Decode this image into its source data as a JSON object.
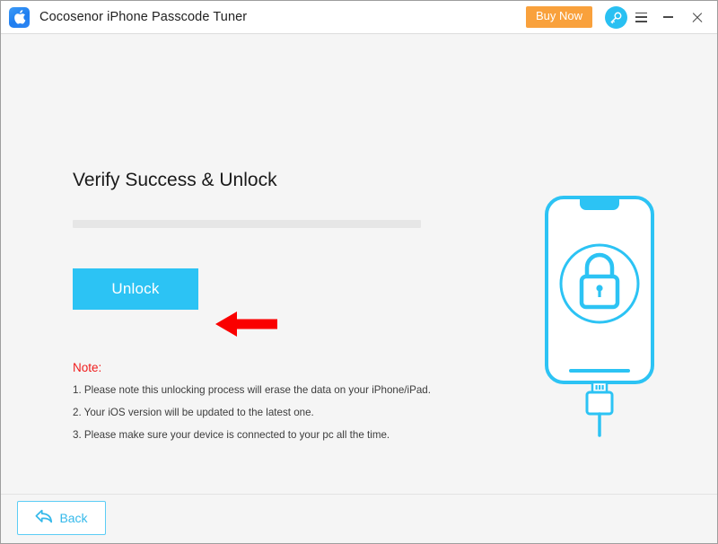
{
  "window": {
    "title": "Cocosenor iPhone Passcode Tuner",
    "app_icon": "apple-logo-icon",
    "accent_color": "#29c0f2",
    "buy_color": "#f9a13c",
    "note_color": "#f01c1c"
  },
  "titlebar": {
    "buy_now_label": "Buy Now",
    "key_icon": "key-icon",
    "menu_icon": "hamburger-menu-icon",
    "minimize_icon": "minimize-icon",
    "close_icon": "close-icon"
  },
  "main": {
    "heading": "Verify Success & Unlock",
    "progress": {
      "percent": 0,
      "track_color": "#e6e6e6"
    },
    "unlock_label": "Unlock",
    "pointer_icon": "red-left-arrow-icon",
    "note_title": "Note:",
    "notes": [
      "1. Please note this unlocking process will erase the data on your iPhone/iPad.",
      "2. Your iOS version will be updated to the latest one.",
      "3. Please make sure your device is connected to your pc all the time."
    ],
    "illustration": {
      "device": "iphone-locked-illustration",
      "lock_icon": "lock-icon",
      "cable_icon": "usb-cable-icon",
      "color": "#2cc3f4"
    }
  },
  "footer": {
    "back_label": "Back",
    "back_icon": "back-arrow-icon"
  }
}
